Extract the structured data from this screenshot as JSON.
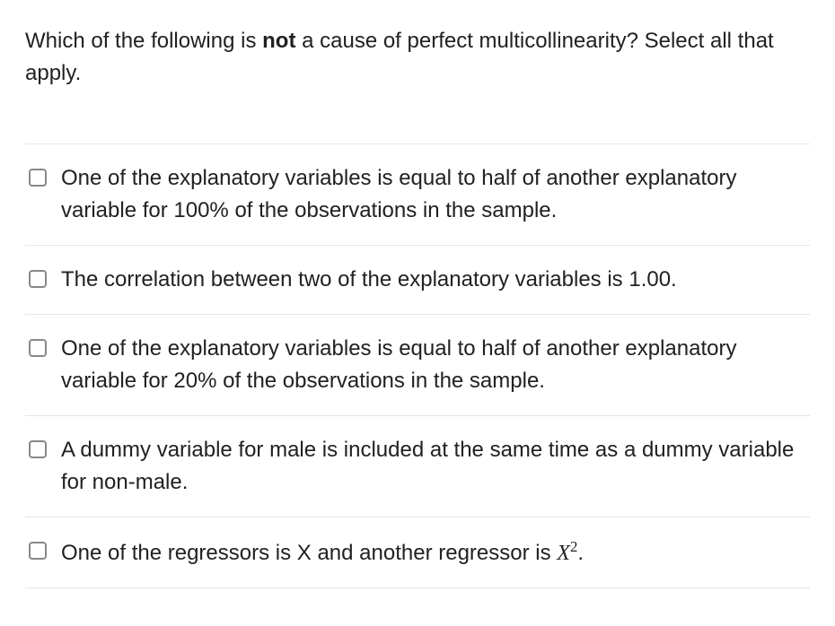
{
  "question": {
    "prefix": "Which of the following is ",
    "bold_word": "not",
    "suffix": " a cause of perfect multicollinearity? Select all that apply."
  },
  "options": [
    {
      "text": "One of the explanatory variables is equal to half of another explanatory variable for 100% of the observations in the sample.",
      "has_math": false
    },
    {
      "text": "The correlation between two of the explanatory variables is 1.00.",
      "has_math": false
    },
    {
      "text": "One of the explanatory variables is equal to half of another explanatory variable for 20% of the observations in the sample.",
      "has_math": false
    },
    {
      "text": "A dummy variable for male is included at the same time as a dummy variable for non-male.",
      "has_math": false
    },
    {
      "text_prefix": "One of the regressors is X and another regressor is ",
      "math_base": "X",
      "math_exponent": "2",
      "text_suffix": ".",
      "has_math": true
    }
  ]
}
